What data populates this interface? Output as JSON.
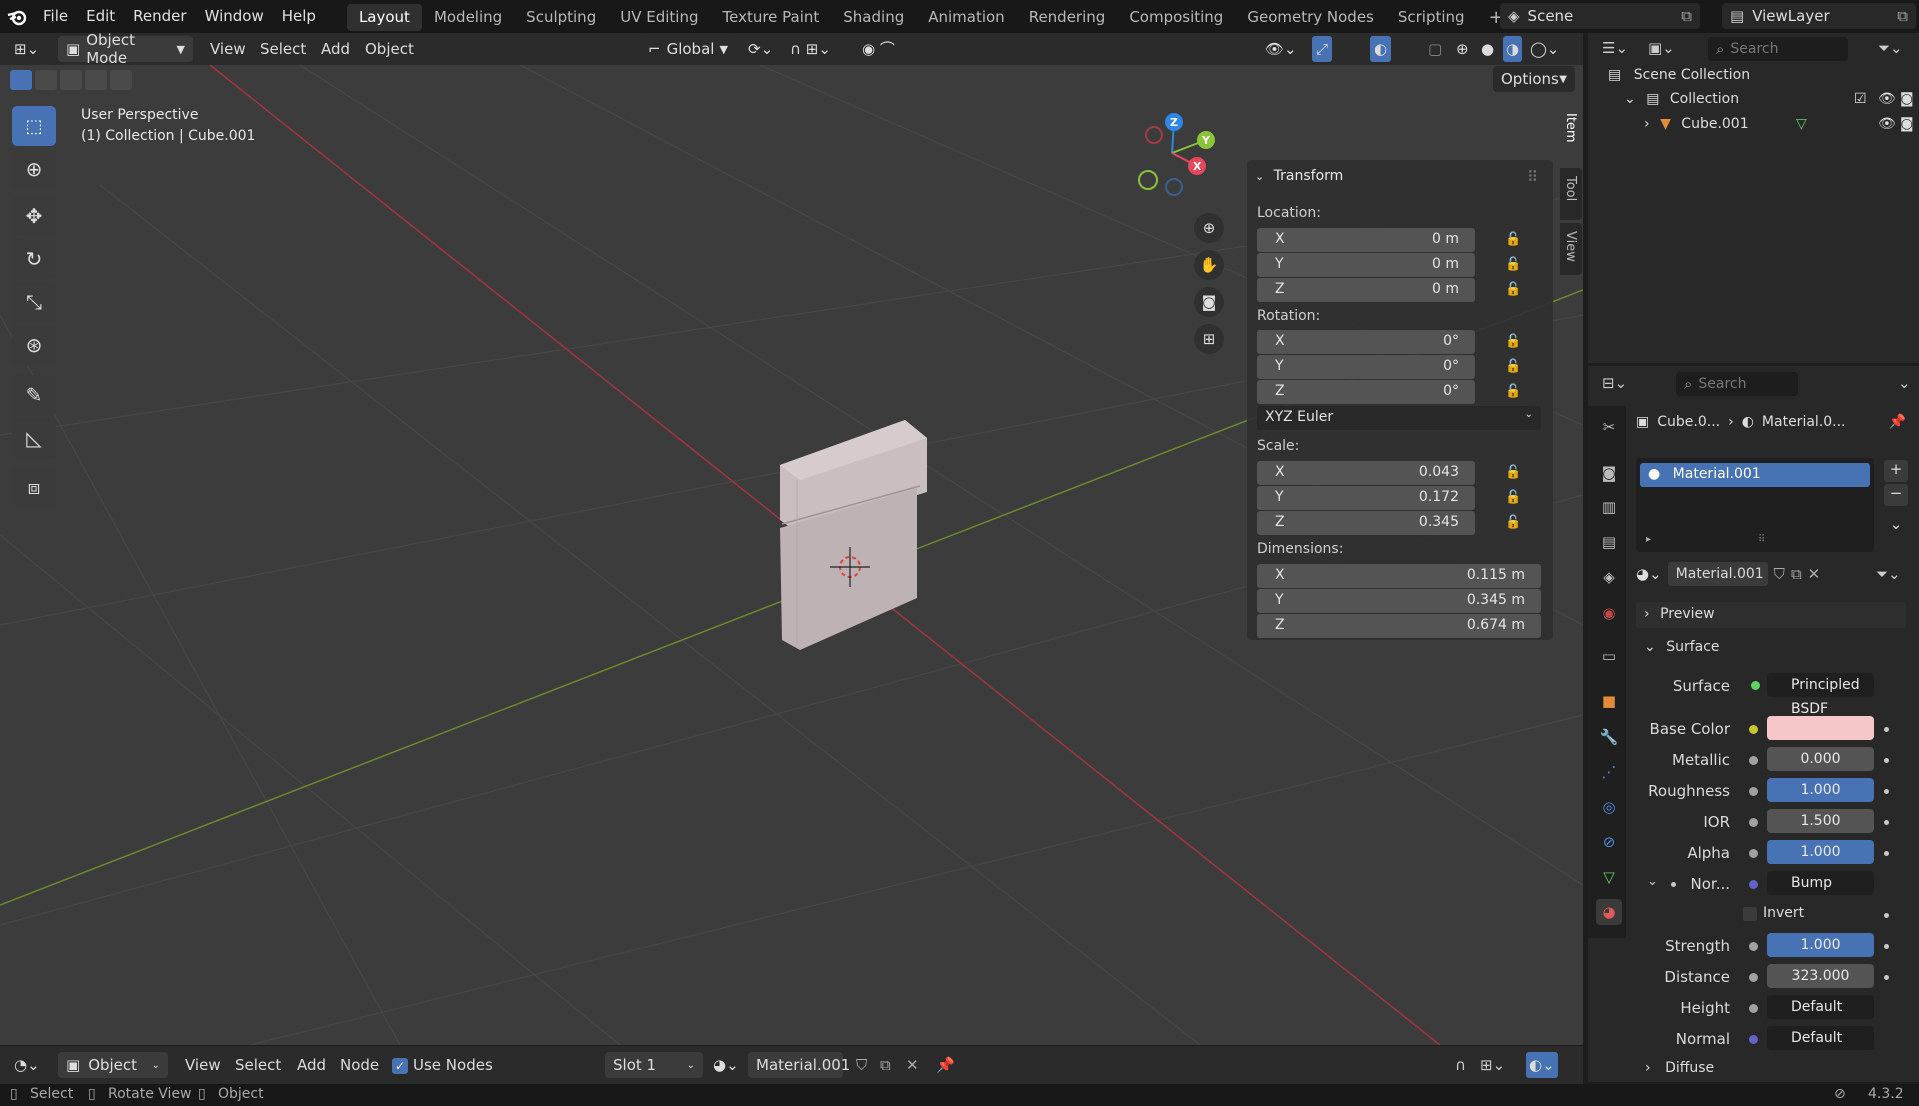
{
  "topbar": {
    "menus": [
      "File",
      "Edit",
      "Render",
      "Window",
      "Help"
    ],
    "workspaces": [
      "Layout",
      "Modeling",
      "Sculpting",
      "UV Editing",
      "Texture Paint",
      "Shading",
      "Animation",
      "Rendering",
      "Compositing",
      "Geometry Nodes",
      "Scripting"
    ],
    "active_workspace": "Layout",
    "scene_label": "Scene",
    "viewlayer_label": "ViewLayer"
  },
  "viewport_header": {
    "mode": "Object Mode",
    "menus": [
      "View",
      "Select",
      "Add",
      "Object"
    ],
    "orientation": "Global",
    "options_label": "Options"
  },
  "viewport": {
    "overlay_line1": "User Perspective",
    "overlay_line2": "(1) Collection | Cube.001",
    "gizmo_axes": [
      "Z",
      "Y",
      "X"
    ]
  },
  "npanel": {
    "tabs": [
      "Item",
      "Tool",
      "View"
    ],
    "section_title": "Transform",
    "location_label": "Location:",
    "location": [
      {
        "axis": "X",
        "value": "0 m"
      },
      {
        "axis": "Y",
        "value": "0 m"
      },
      {
        "axis": "Z",
        "value": "0 m"
      }
    ],
    "rotation_label": "Rotation:",
    "rotation": [
      {
        "axis": "X",
        "value": "0°"
      },
      {
        "axis": "Y",
        "value": "0°"
      },
      {
        "axis": "Z",
        "value": "0°"
      }
    ],
    "rotation_mode": "XYZ Euler",
    "scale_label": "Scale:",
    "scale": [
      {
        "axis": "X",
        "value": "0.043"
      },
      {
        "axis": "Y",
        "value": "0.172"
      },
      {
        "axis": "Z",
        "value": "0.345"
      }
    ],
    "dimensions_label": "Dimensions:",
    "dimensions": [
      {
        "axis": "X",
        "value": "0.115 m"
      },
      {
        "axis": "Y",
        "value": "0.345 m"
      },
      {
        "axis": "Z",
        "value": "0.674 m"
      }
    ]
  },
  "outliner": {
    "search_placeholder": "Search",
    "scene_collection": "Scene Collection",
    "collection": "Collection",
    "object": "Cube.001"
  },
  "properties": {
    "search_placeholder": "Search",
    "breadcrumb_object": "Cube.0...",
    "breadcrumb_material": "Material.0...",
    "slot_name": "Material.001",
    "material_name": "Material.001",
    "preview_label": "Preview",
    "surface_section": "Surface",
    "rows": {
      "surface": {
        "label": "Surface",
        "value": "Principled BSDF"
      },
      "base_color": {
        "label": "Base Color",
        "color": "#f5c7c9"
      },
      "metallic": {
        "label": "Metallic",
        "value": "0.000"
      },
      "roughness": {
        "label": "Roughness",
        "value": "1.000"
      },
      "ior": {
        "label": "IOR",
        "value": "1.500"
      },
      "alpha": {
        "label": "Alpha",
        "value": "1.000"
      },
      "normal": {
        "label": "Nor...",
        "value": "Bump"
      },
      "invert": {
        "label": "Invert"
      },
      "strength": {
        "label": "Strength",
        "value": "1.000"
      },
      "distance": {
        "label": "Distance",
        "value": "323.000"
      },
      "height": {
        "label": "Height",
        "value": "Default"
      },
      "normal2": {
        "label": "Normal",
        "value": "Default"
      }
    },
    "diffuse_label": "Diffuse"
  },
  "bottom_header": {
    "editor_mode": "Object",
    "menus": [
      "View",
      "Select",
      "Add",
      "Node"
    ],
    "use_nodes_label": "Use Nodes",
    "slot": "Slot 1",
    "material": "Material.001"
  },
  "statusbar": {
    "items": [
      "Select",
      "Rotate View",
      "Object"
    ],
    "version": "4.3.2"
  },
  "colors": {
    "accent": "#4772b3",
    "x_axis": "#e7475a",
    "y_axis": "#8bc43a",
    "z_axis": "#2f86e8"
  }
}
